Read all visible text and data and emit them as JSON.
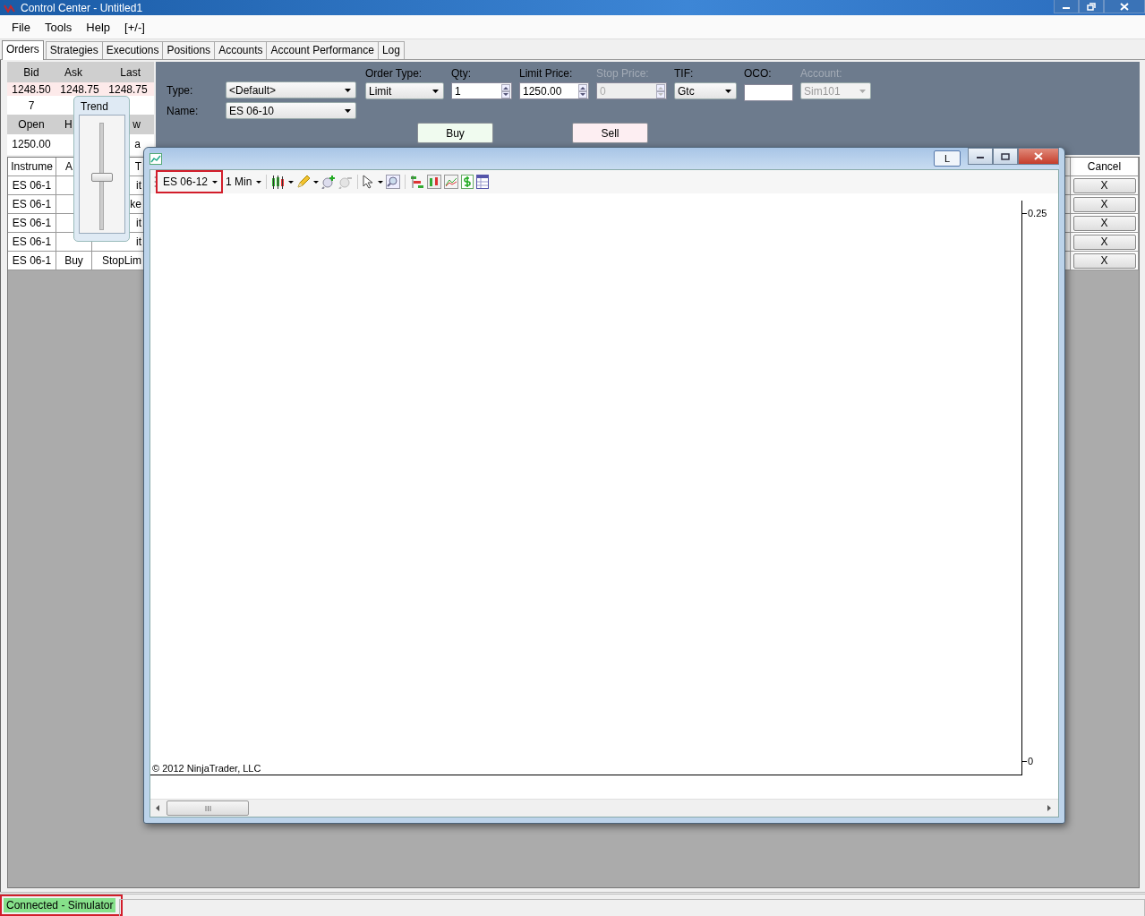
{
  "window": {
    "title": "Control Center - Untitled1"
  },
  "menu": [
    {
      "label": "File"
    },
    {
      "label": "Tools"
    },
    {
      "label": "Help"
    },
    {
      "label": "[+/-]"
    }
  ],
  "tabs": [
    {
      "label": "Orders",
      "selected": true
    },
    {
      "label": "Strategies",
      "selected": false
    },
    {
      "label": "Executions",
      "selected": false
    },
    {
      "label": "Positions",
      "selected": false
    },
    {
      "label": "Accounts",
      "selected": false
    },
    {
      "label": "Account Performance",
      "selected": false
    },
    {
      "label": "Log",
      "selected": false
    }
  ],
  "market_data": {
    "rows": [
      {
        "kind": "header",
        "cells": [
          "Bid",
          "Ask",
          "Last"
        ]
      },
      {
        "kind": "quote",
        "cells": [
          "1248.50",
          "1248.75",
          "1248.75"
        ]
      },
      {
        "kind": "value",
        "cells": [
          "7",
          null,
          null
        ]
      },
      {
        "kind": "header",
        "cells": [
          "Open",
          "H",
          "w"
        ]
      },
      {
        "kind": "value",
        "cells": [
          "1250.00",
          null,
          "a"
        ]
      }
    ]
  },
  "order_entry": {
    "type_label": "Type:",
    "type_value": "<Default>",
    "name_label": "Name:",
    "name_value": "ES 06-10",
    "fields": [
      {
        "kind": "combo",
        "label": "Order Type:",
        "value": "Limit",
        "disabled": false
      },
      {
        "kind": "spinner",
        "label": "Qty:",
        "value": "1",
        "disabled": false
      },
      {
        "kind": "spinner",
        "label": "Limit Price:",
        "value": "1250.00",
        "disabled": false
      },
      {
        "kind": "spinner",
        "label": "Stop Price:",
        "value": "0",
        "disabled": true
      },
      {
        "kind": "combo",
        "label": "TIF:",
        "value": "Gtc",
        "disabled": false
      },
      {
        "kind": "text",
        "label": "OCO:",
        "disabled": false
      },
      {
        "kind": "combo",
        "label": "Account:",
        "value": "Sim101",
        "disabled": true
      }
    ],
    "buttons": [
      {
        "kind": "buy",
        "label": "Buy"
      },
      {
        "kind": "sell",
        "label": "Sell"
      }
    ]
  },
  "orders": {
    "columns": [
      "Instrume",
      "A",
      "T",
      "Cancel"
    ],
    "rows": [
      {
        "instrument": "ES 06-1",
        "action": null,
        "type": "it",
        "cancel": "X"
      },
      {
        "instrument": "ES 06-1",
        "action": null,
        "type": "ke",
        "cancel": "X"
      },
      {
        "instrument": "ES 06-1",
        "action": null,
        "type": "it",
        "cancel": "X"
      },
      {
        "instrument": "ES 06-1",
        "action": null,
        "type": "it",
        "cancel": "X"
      },
      {
        "instrument": "ES 06-1",
        "action": "Buy",
        "type": "StopLim",
        "cancel": "X"
      }
    ]
  },
  "trend_popup": {
    "title": "Trend",
    "level": 0.5
  },
  "chart_window": {
    "pin_label": "L",
    "instrument": "ES 06-12",
    "interval": "1 Min",
    "y_labels": [
      "0.25",
      "0"
    ],
    "copyright": "© 2012 NinjaTrader, LLC"
  },
  "status_bar": {
    "connection": "Connected - Simulator"
  }
}
